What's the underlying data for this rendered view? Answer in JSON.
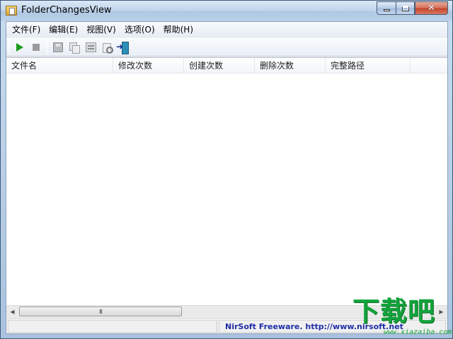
{
  "window": {
    "title": "FolderChangesView",
    "caption_close": "✕"
  },
  "menu": {
    "items": [
      "文件(F)",
      "编辑(E)",
      "视图(V)",
      "选项(O)",
      "帮助(H)"
    ]
  },
  "toolbar": {
    "icons": [
      "play-icon",
      "stop-icon",
      "save-icon",
      "copy-icon",
      "properties-icon",
      "find-icon",
      "exit-icon"
    ]
  },
  "table": {
    "columns": [
      "文件名",
      "修改次数",
      "创建次数",
      "删除次数",
      "完整路径"
    ],
    "rows": []
  },
  "scrollbar": {
    "left_arrow": "◀",
    "right_arrow": "▶",
    "thumb_grip": "III"
  },
  "status": {
    "left": "",
    "right": "NirSoft Freeware.  http://www.nirsoft.net"
  },
  "watermark": {
    "text": "下载吧",
    "url": "www.xiazaiba.com"
  },
  "colors": {
    "titlebar": "#c3d6ec",
    "status_link": "#1f2fa8",
    "play": "#1c9a1c",
    "watermark": "#12a33b"
  }
}
